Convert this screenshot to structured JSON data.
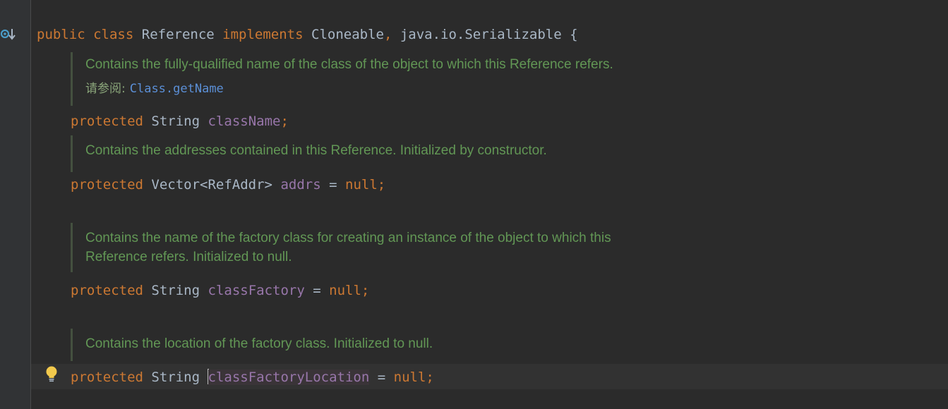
{
  "editor": {
    "class_decl": {
      "kw_public": "public",
      "kw_class": "class",
      "class_name": "Reference",
      "kw_implements": "implements",
      "iface1": "Cloneable",
      "comma": ",",
      "iface2": "java.io.Serializable",
      "brace": "{"
    },
    "doc1": {
      "text": "Contains the fully-qualified name of the class of the object to which this Reference refers.",
      "see_label": "请参阅:",
      "see_link": "Class.getName"
    },
    "field1": {
      "modifier": "protected",
      "type": "String",
      "name": "className",
      "semicolon": ";"
    },
    "doc2": {
      "text": "Contains the addresses contained in this Reference. Initialized by constructor."
    },
    "field2": {
      "modifier": "protected",
      "type": "Vector<RefAddr>",
      "name": "addrs",
      "assign": "=",
      "value": "null",
      "semicolon": ";"
    },
    "doc3": {
      "line1": "Contains the name of the factory class for creating an instance of the object to which this",
      "line2": "Reference refers. Initialized to null."
    },
    "field3": {
      "modifier": "protected",
      "type": "String",
      "name": "classFactory",
      "assign": "=",
      "value": "null",
      "semicolon": ";"
    },
    "doc4": {
      "text": "Contains the location of the factory class. Initialized to null."
    },
    "field4": {
      "modifier": "protected",
      "type": "String",
      "name": "classFactoryLocation",
      "assign": "=",
      "value": "null",
      "semicolon": ";"
    },
    "gutter_icon": "implements-override-icon",
    "intention_icon": "lightbulb-icon"
  }
}
